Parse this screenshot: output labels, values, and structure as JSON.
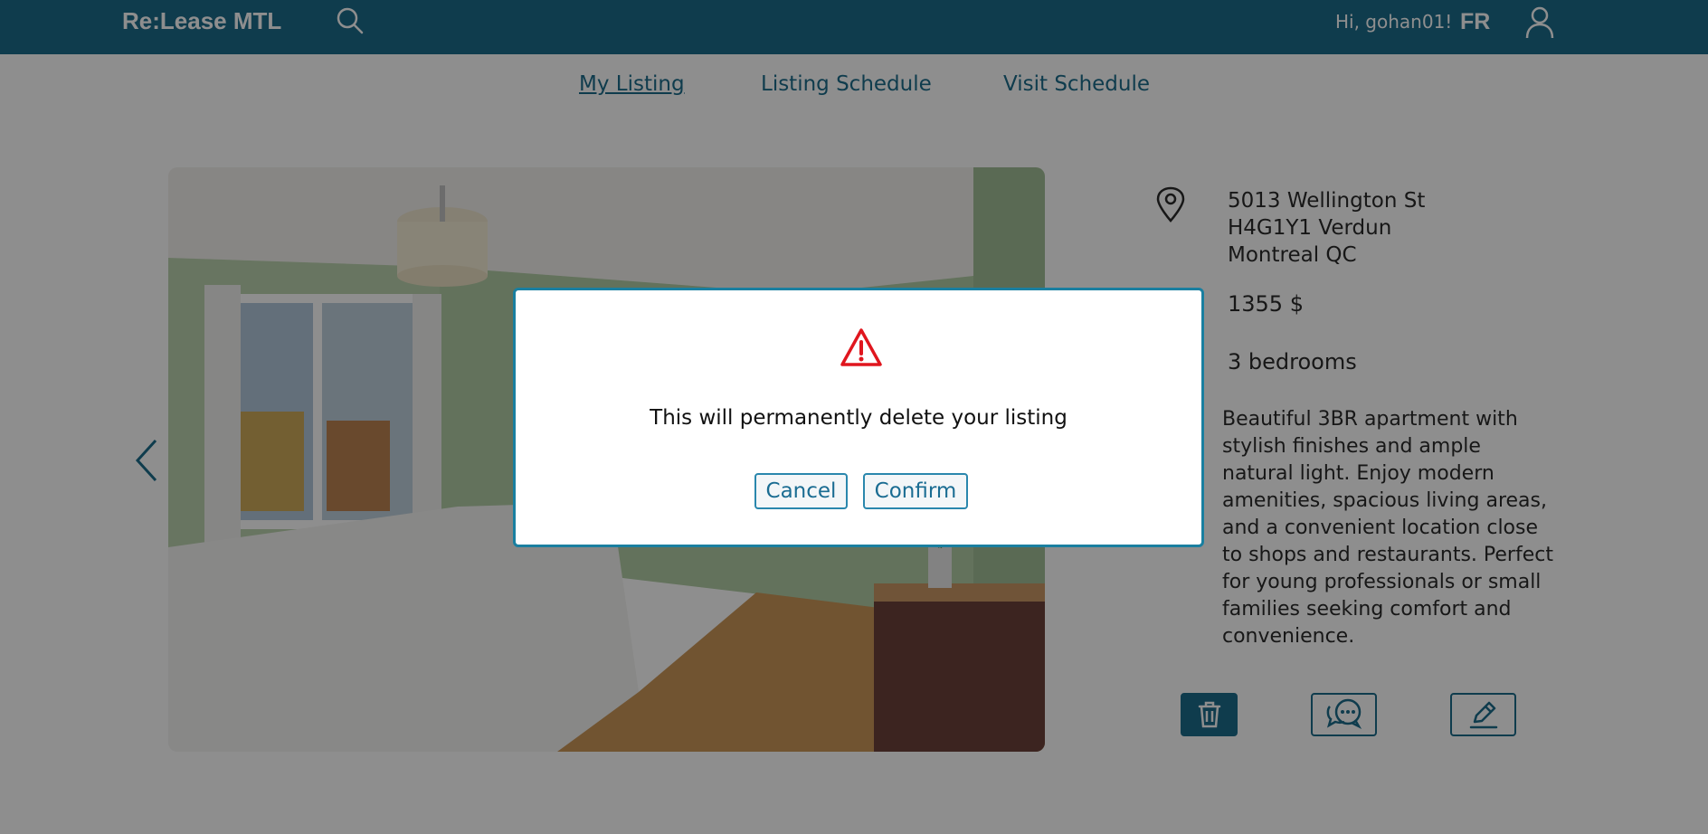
{
  "header": {
    "brand": "Re:Lease MTL",
    "greeting": "Hi, gohan01!",
    "language": "FR",
    "icons": {
      "search": "search-icon",
      "user": "user-icon"
    }
  },
  "tabs": [
    {
      "label": "My Listing",
      "active": true
    },
    {
      "label": "Listing Schedule",
      "active": false
    },
    {
      "label": "Visit Schedule",
      "active": false
    }
  ],
  "listing": {
    "address_line1": "5013 Wellington St",
    "address_line2": "H4G1Y1 Verdun",
    "address_line3": "Montreal QC",
    "price": "1355 $",
    "bedrooms": "3 bedrooms",
    "description": "Beautiful 3BR apartment with stylish finishes and ample natural light. Enjoy modern amenities, spacious living areas, and a convenient location close to shops and restaurants. Perfect for young professionals or small families seeking comfort and convenience."
  },
  "actions": {
    "icons": [
      "trash-icon",
      "chat-icon",
      "pencil-icon"
    ]
  },
  "modal": {
    "message": "This will permanently delete your listing",
    "cancel_label": "Cancel",
    "confirm_label": "Confirm",
    "icon": "warning-icon"
  },
  "colors": {
    "primary": "#005a7d",
    "overlay": "rgba(30,30,30,0.5)",
    "warning": "#e0161e"
  }
}
